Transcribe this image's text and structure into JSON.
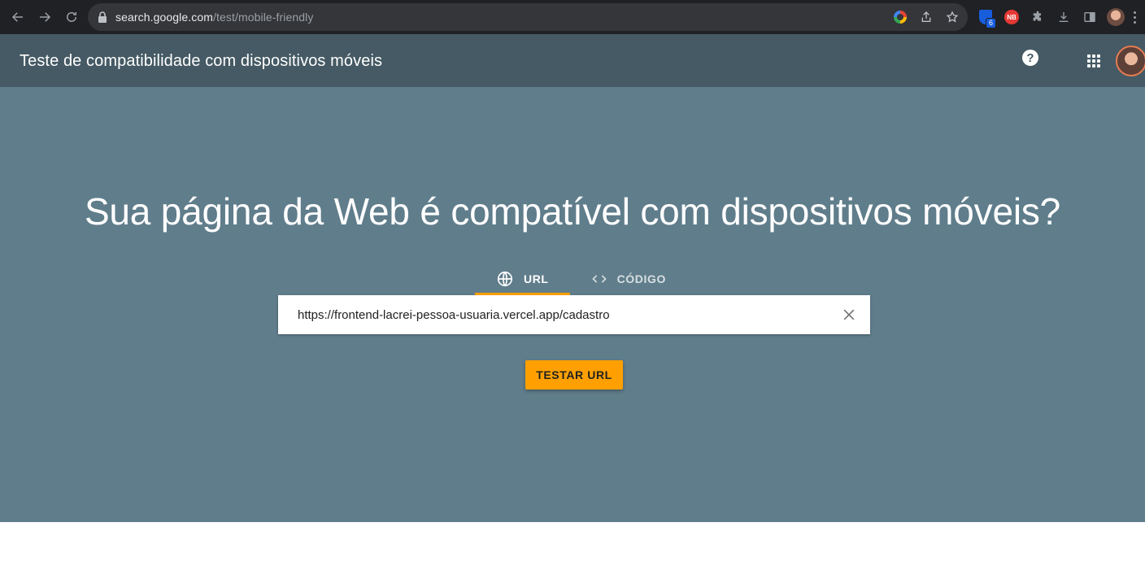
{
  "browser": {
    "url_host": "search.google.com",
    "url_path": "/test/mobile-friendly",
    "extension_badge": "6",
    "extension_red_label": "NB"
  },
  "appbar": {
    "title": "Teste de compatibilidade com dispositivos móveis",
    "help_label": "?"
  },
  "hero": {
    "headline": "Sua página da Web é compatível com dispositivos móveis?",
    "tabs": [
      {
        "label": "URL",
        "icon": "globe-icon",
        "active": true
      },
      {
        "label": "CÓDIGO",
        "icon": "code-icon",
        "active": false
      }
    ],
    "url_value": "https://frontend-lacrei-pessoa-usuaria.vercel.app/cadastro",
    "test_button": "TESTAR URL"
  },
  "colors": {
    "appbar": "#455a64",
    "hero": "#607d8b",
    "accent": "#ffa000"
  }
}
